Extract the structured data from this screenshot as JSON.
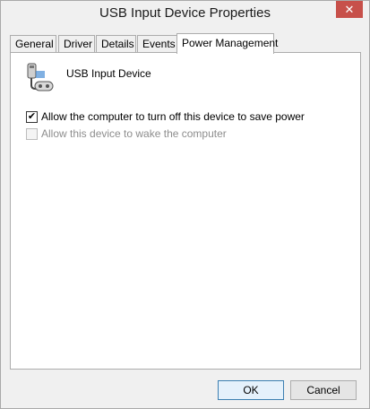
{
  "window": {
    "title": "USB Input Device Properties",
    "close_glyph": "✕"
  },
  "tabs": [
    {
      "label": "General"
    },
    {
      "label": "Driver"
    },
    {
      "label": "Details"
    },
    {
      "label": "Events"
    },
    {
      "label": "Power Management",
      "active": true
    }
  ],
  "device": {
    "name": "USB Input Device",
    "icon": "usb-device-icon"
  },
  "options": [
    {
      "label": "Allow the computer to turn off this device to save power",
      "checked": true,
      "enabled": true
    },
    {
      "label": "Allow this device to wake the computer",
      "checked": false,
      "enabled": false
    }
  ],
  "buttons": {
    "ok": "OK",
    "cancel": "Cancel"
  },
  "colors": {
    "close_button": "#c7504a",
    "default_button_border": "#3c7fb1"
  }
}
